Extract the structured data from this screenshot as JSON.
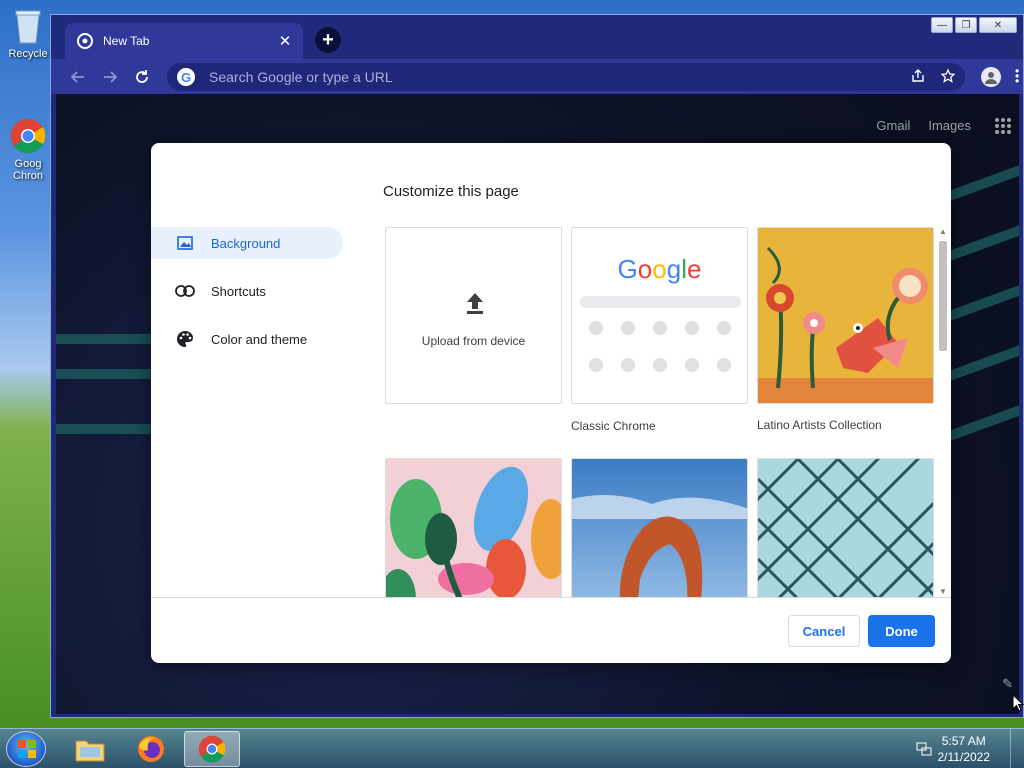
{
  "desktop": {
    "icons": [
      {
        "label": "Recycle"
      },
      {
        "label": "Goog Chron"
      }
    ]
  },
  "browser": {
    "tab_title": "New Tab",
    "omnibox_placeholder": "Search Google or type a URL",
    "ntp_links": [
      "Gmail",
      "Images"
    ]
  },
  "dialog": {
    "title": "Customize this page",
    "nav": [
      {
        "label": "Background",
        "icon": "image-icon",
        "selected": true
      },
      {
        "label": "Shortcuts",
        "icon": "link-icon",
        "selected": false
      },
      {
        "label": "Color and theme",
        "icon": "palette-icon",
        "selected": false
      }
    ],
    "tiles": [
      {
        "label": "Upload from device"
      },
      {
        "label": "Classic Chrome",
        "logo": "Google"
      },
      {
        "label": "Latino Artists Collection"
      }
    ],
    "cancel_label": "Cancel",
    "done_label": "Done",
    "accent": "#1a73e8"
  },
  "taskbar": {
    "time": "5:57 AM",
    "date": "2/11/2022"
  }
}
